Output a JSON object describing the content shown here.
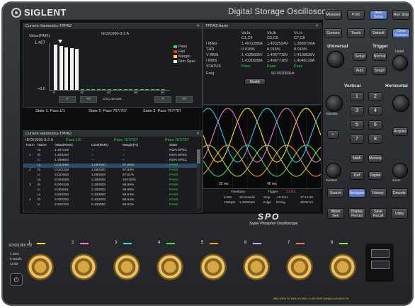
{
  "brand": {
    "name": "SIGLENT",
    "model_title": "Digital Storage Oscilloscope"
  },
  "harmonics_window": {
    "title": "Current Harmonics-TPPA2",
    "ylabel": "Value(RMS)",
    "standard": "IEC61000-3-2 A",
    "ymax": "1.407",
    "yzero": "+0.0",
    "legend": [
      {
        "label": "Pass",
        "color": "#39d353"
      },
      {
        "label": "Fail",
        "color": "#e53935"
      },
      {
        "label": "Margin",
        "color": "#fdd835"
      },
      {
        "label": "Non Spec",
        "color": "#f2f2f2"
      }
    ],
    "bar_fraction": [
      1.0,
      0.97,
      0.94,
      0.92,
      0.9,
      0.02,
      0.02,
      0.02,
      0.02,
      0.02,
      0.02,
      0.02,
      0.02,
      0.02,
      0.02,
      0.02,
      0.02,
      0.02,
      0.02,
      0.02,
      0.02
    ],
    "xticks": [
      "0",
      "10",
      "20",
      "30",
      "40"
    ],
    "page_info": "1/1(1.407228",
    "states": [
      "State 1: Pass 1/1",
      "State 2: Pass 767/767",
      "State 3: Pass 767/767"
    ]
  },
  "harm_window": {
    "title": "TPPA2:Harm",
    "columns": [
      "",
      "Va,Ia\nC1,C4",
      "Vb,Ib\nC5,C5",
      "Vc,Ic\nC7,C8"
    ],
    "col_heads": [
      "Va,Ia",
      "Vb,Ib",
      "Vc,Ic"
    ],
    "col_subs": [
      "C1,C4",
      "C5,C5",
      "C7,C8"
    ],
    "rows": [
      {
        "name": "I MAG",
        "values": [
          "1.4072285A",
          "1.4032534V",
          "1.3999726A"
        ]
      },
      {
        "name": "THD",
        "values": [
          "0.016%",
          "0.016%",
          "0.016%"
        ]
      },
      {
        "name": "V RMS",
        "values": [
          "1.4135835V",
          "1.4067718V",
          "1.4109636V"
        ]
      },
      {
        "name": "I RMS",
        "values": [
          "1.4130938A",
          "1.4067718V",
          "1.4045119A"
        ]
      },
      {
        "name": "STATUS",
        "values": [
          "Pass",
          "Pass",
          "Pass"
        ]
      }
    ],
    "freq_label": "Freq",
    "freq_value": "50.002083Hz",
    "modify_label": "Modify"
  },
  "table_window": {
    "title": "Current Harmonics-TPPA2",
    "standard": "IEC61000-3-2 A",
    "pass_counts": [
      "Pass 1/1",
      "Pass 767/767",
      "Pass 767/767"
    ],
    "headers": [
      "Harm",
      "Name",
      "Value(RMS)",
      "Limit(RMS)",
      "Margin(%)",
      "State"
    ],
    "rows": [
      [
        "",
        "Ia",
        "1.407228",
        "--",
        "--",
        "NON SPEC"
      ],
      [
        "1",
        "Ib",
        "1.403253",
        "--",
        "--",
        "NON SPEC"
      ],
      [
        "",
        "Ic",
        "1.399802",
        "--",
        "--",
        "NON SPEC"
      ],
      [
        "",
        "Ia",
        "0.022895",
        "1.080000",
        "97.88%",
        "PASS"
      ],
      [
        "2",
        "Ib",
        "0.022338",
        "1.080000",
        "97.93%",
        "PASS"
      ],
      [
        "",
        "Ic",
        "0.022603",
        "1.080000",
        "97.91%",
        "PASS"
      ],
      [
        "",
        "Ia",
        "0.000069",
        "2.300000",
        "100.00%",
        "PASS"
      ],
      [
        "3",
        "Ib",
        "0.000319",
        "2.300000",
        "99.99%",
        "PASS"
      ],
      [
        "",
        "Ic",
        "0.000551",
        "2.300000",
        "99.98%",
        "PASS"
      ],
      [
        "",
        "Ia",
        "0.000250",
        "0.430000",
        "99.94%",
        "PASS"
      ],
      [
        "4",
        "Ib",
        "0.000252",
        "0.430000",
        "99.94%",
        "PASS"
      ],
      [
        "",
        "Ic",
        "0.000332",
        "0.430000",
        "99.92%",
        "PASS"
      ]
    ]
  },
  "waveform": {
    "time_labels": [
      "20 ms",
      "40 ms"
    ],
    "colors": [
      "#f5e13b",
      "#e97ad8",
      "#43c6e8",
      "#45d36b",
      "#f09a3a",
      "#a0d860"
    ]
  },
  "status_bar": {
    "timebase_label": "Timebase",
    "timebase_values": [
      "0.00s",
      "10.0ms/div",
      "125kpts",
      "1.25MSa/s"
    ],
    "trigger_label": "Trigger",
    "trigger_values": [
      "Stop",
      "Edge",
      "-10.0mA",
      "Rising"
    ],
    "trigger_channel": "C8 DC",
    "clock": "17:12:49",
    "date": "2025/1/4"
  },
  "series_logo": {
    "name": "SPO",
    "subtitle": "Super Phosphor Oscilloscope"
  },
  "panel": {
    "top_keys": [
      "Measure",
      "Print",
      "Auto Setup",
      "Run Stop",
      "Cursors",
      "Touch",
      "Default",
      "Clear Sweeps"
    ],
    "universal_label": "Universal",
    "trigger_label": "Trigger",
    "trigger_keys": [
      "Setup",
      "Normal",
      "Auto",
      "Single"
    ],
    "level_label": "Level",
    "vertical_label": "Vertical",
    "horizontal_label": "Horizontal",
    "channel_keys": [
      "1",
      "2",
      "3",
      "4",
      "5",
      "6",
      "7",
      "8"
    ],
    "function_keys": [
      "Math",
      "Memory",
      "Ref",
      "Digital"
    ],
    "acquire_label": "Acquire",
    "volts_label": "Volts/div",
    "position_label": "Position",
    "zoom_label": "Zoom",
    "bottom_keys": [
      "Search",
      "Navigate",
      "History",
      "Decode",
      "Wave Gen",
      "Display Persist",
      "Save Recall",
      "Utility"
    ]
  },
  "front": {
    "model_label": "SDS5108X HD",
    "specs": [
      "1 GHz",
      "5 GSa/s",
      "12-bit"
    ],
    "channels": [
      "1",
      "2",
      "3",
      "4",
      "5",
      "6",
      "7",
      "8"
    ],
    "channel_colors": [
      "#f5e13b",
      "#e97ad8",
      "#43c6e8",
      "#45d36b",
      "#f09a3a",
      "#c9a9ff",
      "#ff6b6b",
      "#a0d860"
    ],
    "warning": "BNC INPUTS  1MΩ±1% 50Ω ±1.5% RMS  1MΩ||20 pF±400V Pk"
  }
}
